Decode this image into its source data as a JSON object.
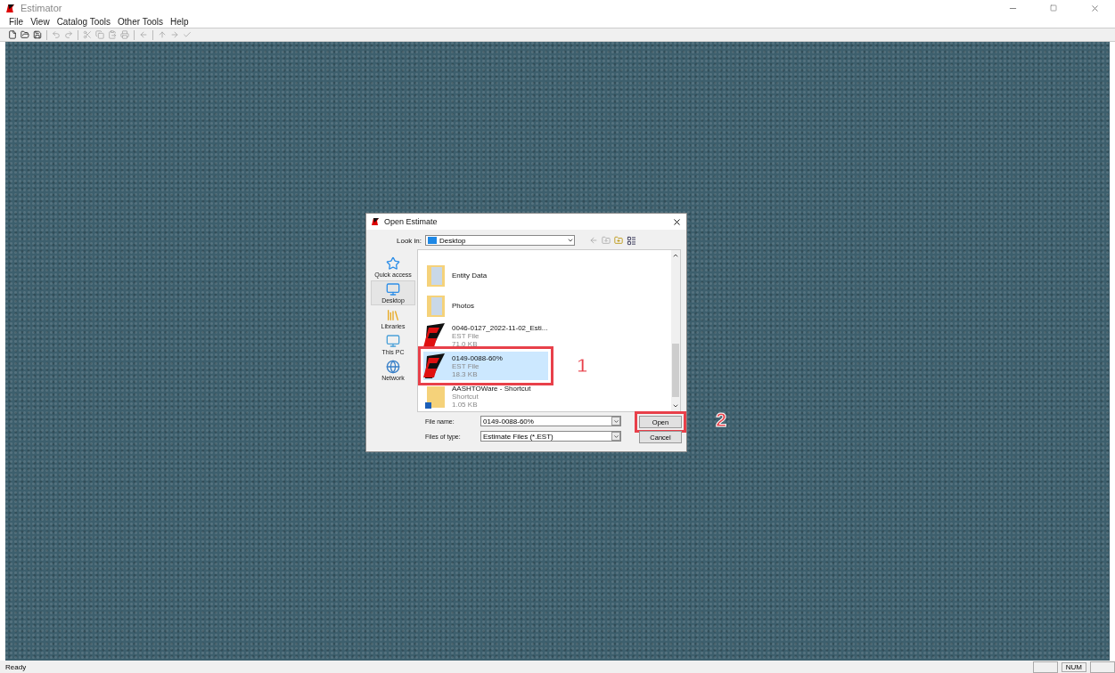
{
  "window": {
    "title": "Estimator"
  },
  "menu": [
    "File",
    "View",
    "Catalog Tools",
    "Other Tools",
    "Help"
  ],
  "toolbar": [
    {
      "kind": "new",
      "disabled": false
    },
    {
      "kind": "open",
      "disabled": false
    },
    {
      "kind": "save",
      "disabled": false
    },
    {
      "kind": "sep"
    },
    {
      "kind": "undo",
      "disabled": true
    },
    {
      "kind": "redo",
      "disabled": true
    },
    {
      "kind": "sep"
    },
    {
      "kind": "cut",
      "disabled": true
    },
    {
      "kind": "copy",
      "disabled": true
    },
    {
      "kind": "paste",
      "disabled": true
    },
    {
      "kind": "print",
      "disabled": true
    },
    {
      "kind": "sep"
    },
    {
      "kind": "back",
      "disabled": true
    },
    {
      "kind": "sep"
    },
    {
      "kind": "up",
      "disabled": true
    },
    {
      "kind": "forward",
      "disabled": true
    },
    {
      "kind": "check",
      "disabled": true
    }
  ],
  "dialog": {
    "title": "Open Estimate",
    "look_in_label": "Look in:",
    "look_in_value": "Desktop",
    "places": [
      {
        "label": "Quick access",
        "kind": "star",
        "selected": false
      },
      {
        "label": "Desktop",
        "kind": "desktop",
        "selected": true
      },
      {
        "label": "Libraries",
        "kind": "libraries",
        "selected": false
      },
      {
        "label": "This PC",
        "kind": "pc",
        "selected": false
      },
      {
        "label": "Network",
        "kind": "network",
        "selected": false
      }
    ],
    "files": [
      {
        "kind": "folder",
        "name": "Entity Data",
        "selected": false
      },
      {
        "kind": "folder",
        "name": "Photos",
        "selected": false
      },
      {
        "kind": "est",
        "name": "0046-0127_2022-11-02_Esti...",
        "type": "EST File",
        "size": "71.0 KB",
        "selected": false
      },
      {
        "kind": "est",
        "name": "0149-0088-60%",
        "type": "EST File",
        "size": "18.3 KB",
        "selected": true,
        "annotation": "1"
      },
      {
        "kind": "shortcut",
        "name": "AASHTOWare - Shortcut",
        "type": "Shortcut",
        "size": "1.05 KB",
        "selected": false
      }
    ],
    "file_name_label": "File name:",
    "file_name_value": "0149-0088-60%",
    "file_type_label": "Files of type:",
    "file_type_value": "Estimate Files (*.EST)",
    "open_button": "Open",
    "open_annotation": "2",
    "cancel_button": "Cancel"
  },
  "status_bar": {
    "text": "Ready",
    "indicators": [
      "NUM"
    ]
  }
}
